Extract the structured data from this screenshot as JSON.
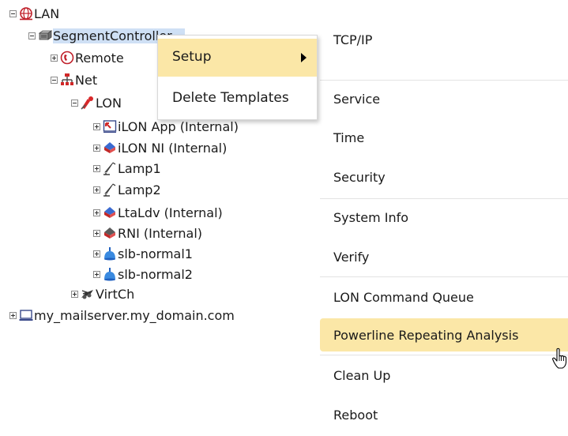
{
  "tree": {
    "root": "LAN",
    "segment_controller": "SegmentController",
    "remote": "Remote",
    "net": "Net",
    "lon": "LON",
    "ilon_app": "iLON App (Internal)",
    "ilon_ni": "iLON NI (Internal)",
    "lamp1": "Lamp1",
    "lamp2": "Lamp2",
    "ltaldv": "LtaLdv (Internal)",
    "rni": "RNI (Internal)",
    "slb1": "slb-normal1",
    "slb2": "slb-normal2",
    "virtch": "VirtCh",
    "mailserver": "my_mailserver.my_domain.com"
  },
  "context_menu": {
    "setup": "Setup",
    "delete_templates": "Delete Templates"
  },
  "setup_submenu": {
    "items": [
      "TCP/IP",
      "Service",
      "Time",
      "Security",
      "System Info",
      "Verify",
      "LON Command Queue",
      "Powerline Repeating Analysis",
      "Clean Up",
      "Reboot"
    ],
    "highlighted": "Powerline Repeating Analysis"
  },
  "colors": {
    "selection": "#cfe0f5",
    "menu_highlight": "#fbe7a7"
  }
}
